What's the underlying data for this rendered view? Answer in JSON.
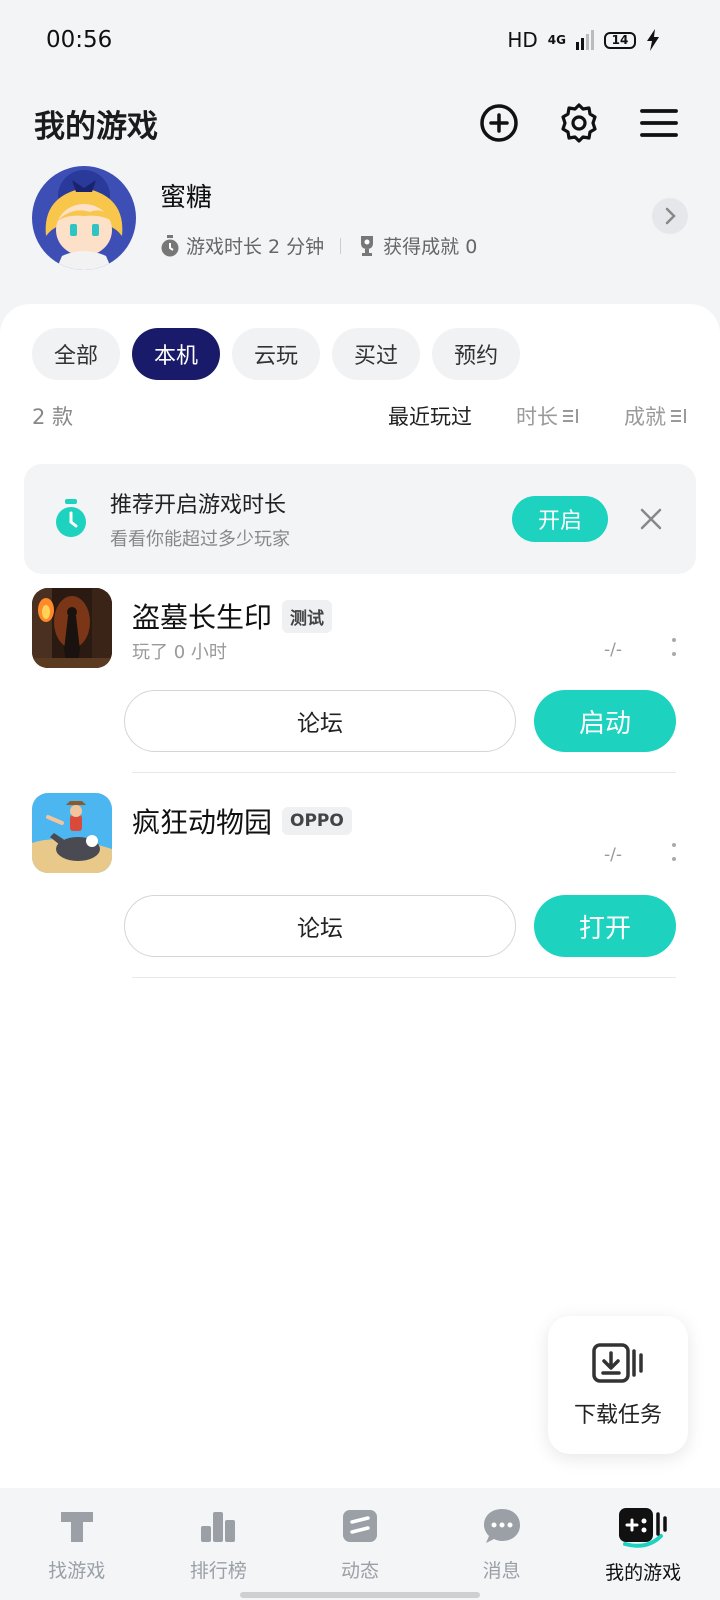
{
  "status_bar": {
    "time": "00:56",
    "hd": "HD",
    "network": "4G",
    "battery": "14"
  },
  "header": {
    "title": "我的游戏",
    "icons": [
      "add-circle-icon",
      "gear-icon",
      "menu-icon"
    ]
  },
  "profile": {
    "name": "蜜糖",
    "play_time": "游戏时长 2 分钟",
    "achievements": "获得成就 0"
  },
  "filters": [
    {
      "label": "全部",
      "active": false
    },
    {
      "label": "本机",
      "active": true
    },
    {
      "label": "云玩",
      "active": false
    },
    {
      "label": "买过",
      "active": false
    },
    {
      "label": "预约",
      "active": false
    }
  ],
  "sort": {
    "count": "2 款",
    "options": [
      "最近玩过",
      "时长",
      "成就"
    ],
    "active": "最近玩过"
  },
  "banner": {
    "title": "推荐开启游戏时长",
    "subtitle": "看看你能超过多少玩家",
    "button": "开启"
  },
  "games": [
    {
      "name": "盗墓长生印",
      "tag": "测试",
      "played": "玩了 0 小时",
      "score": "-/-",
      "forum": "论坛",
      "action": "启动"
    },
    {
      "name": "疯狂动物园",
      "tag": "OPPO",
      "played": "",
      "score": "-/-",
      "forum": "论坛",
      "action": "打开"
    }
  ],
  "fab": {
    "label": "下载任务"
  },
  "tabs": [
    {
      "label": "找游戏",
      "icon": "find-game-icon"
    },
    {
      "label": "排行榜",
      "icon": "ranking-icon"
    },
    {
      "label": "动态",
      "icon": "feed-icon"
    },
    {
      "label": "消息",
      "icon": "message-icon"
    },
    {
      "label": "我的游戏",
      "icon": "my-games-icon",
      "active": true
    }
  ],
  "colors": {
    "accent": "#1dd3c0",
    "active_chip": "#1a1a6b"
  }
}
